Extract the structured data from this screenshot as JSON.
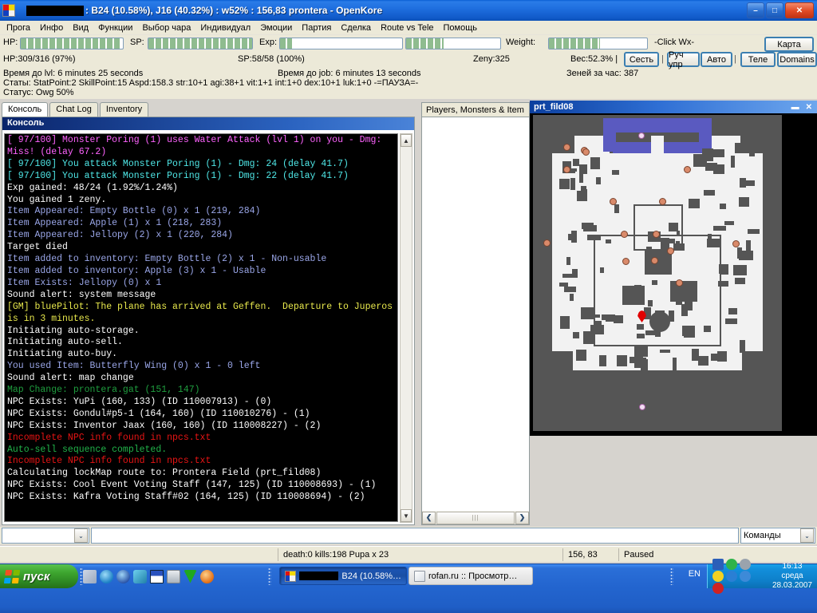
{
  "window": {
    "title": ": B24 (10.58%), J16 (40.32%) : w52% : 156,83 prontera - OpenKore",
    "minimize_label": "–",
    "maximize_label": "□",
    "close_label": "✕"
  },
  "menu": {
    "items": [
      "Прога",
      "Инфо",
      "Вид",
      "Функции",
      "Выбор чара",
      "Индивидуал",
      "Эмоции",
      "Партия",
      "Сделка",
      "Route vs Tele",
      "Помощь"
    ]
  },
  "gauges": {
    "hp_label": "HP:",
    "hp_percent": 97,
    "sp_label": "SP:",
    "sp_percent": 100,
    "exp_label": "Exp:",
    "exp_percent": 10,
    "job_percent": 40,
    "weight_label": "Weight:",
    "weight_percent": 52,
    "click_hint": "-Click Wx-"
  },
  "stats": {
    "hp_text": "HP:309/316 (97%)",
    "sp_text": "SP:58/58 (100%)",
    "zeny_text": "Zeny:325",
    "weight_text": "Вес:52.3% |",
    "time_lvl": "Время до lvl: 6 minutes 25 seconds",
    "time_job": "Время до job: 6 minutes 13 seconds",
    "zeny_per_hour": "Зеней за час: 387",
    "stats_line": "Статы: StatPoint:2  SkillPoint:15  Aspd:158.3  str:10+1 agi:38+1 vit:1+1 int:1+0 dex:10+1 luk:1+0   -=ПАУЗА=-",
    "status_line": "Статус: Owg 50%"
  },
  "toolbar": {
    "map_button": "Карта",
    "sit_button": "Сесть",
    "manual_button": "Руч упр",
    "auto_button": "Авто",
    "tele_button": "Теле",
    "domains_button": "Domains",
    "separator": "|"
  },
  "tabs": [
    {
      "label": "Консоль",
      "active": true
    },
    {
      "label": "Chat Log",
      "active": false
    },
    {
      "label": "Inventory",
      "active": false
    }
  ],
  "console": {
    "header": "Консоль",
    "lines": [
      {
        "text": "[ 97/100] Monster Poring (1) uses Water Attack (lvl 1) on you - Dmg:",
        "color": "#ff63ff"
      },
      {
        "text": "Miss! (delay 67.2)",
        "color": "#ff63ff"
      },
      {
        "text": "[ 97/100] You attack Monster Poring (1) - Dmg: 24 (delay 41.7)",
        "color": "#4fe8e8"
      },
      {
        "text": "[ 97/100] You attack Monster Poring (1) - Dmg: 22 (delay 41.7)",
        "color": "#4fe8e8"
      },
      {
        "text": "Exp gained: 48/24 (1.92%/1.24%)",
        "color": "#ffffff"
      },
      {
        "text": "You gained 1 zeny.",
        "color": "#ffffff"
      },
      {
        "text": "Item Appeared: Empty Bottle (0) x 1 (219, 284)",
        "color": "#9aa6e8"
      },
      {
        "text": "Item Appeared: Apple (1) x 1 (218, 283)",
        "color": "#9aa6e8"
      },
      {
        "text": "Item Appeared: Jellopy (2) x 1 (220, 284)",
        "color": "#9aa6e8"
      },
      {
        "text": "Target died",
        "color": "#ffffff"
      },
      {
        "text": "Item added to inventory: Empty Bottle (2) x 1 - Non-usable",
        "color": "#9aa6e8"
      },
      {
        "text": "Item added to inventory: Apple (3) x 1 - Usable",
        "color": "#9aa6e8"
      },
      {
        "text": "Item Exists: Jellopy (0) x 1",
        "color": "#9aa6e8"
      },
      {
        "text": "Sound alert: system message",
        "color": "#ffffff"
      },
      {
        "text": "[GM] bluePilot: The plane has arrived at Geffen.  Departure to Juperos",
        "color": "#e8e84c"
      },
      {
        "text": "is in 3 minutes.",
        "color": "#e8e84c"
      },
      {
        "text": "Initiating auto-storage.",
        "color": "#ffffff"
      },
      {
        "text": "Initiating auto-sell.",
        "color": "#ffffff"
      },
      {
        "text": "Initiating auto-buy.",
        "color": "#ffffff"
      },
      {
        "text": "You used Item: Butterfly Wing (0) x 1 - 0 left",
        "color": "#9aa6e8"
      },
      {
        "text": "Sound alert: map change",
        "color": "#ffffff"
      },
      {
        "text": "Map Change: prontera.gat (151, 147)",
        "color": "#1f9e3f"
      },
      {
        "text": "NPC Exists: YuPi (160, 133) (ID 110007913) - (0)",
        "color": "#ffffff"
      },
      {
        "text": "NPC Exists: Gondul#p5-1 (164, 160) (ID 110010276) - (1)",
        "color": "#ffffff"
      },
      {
        "text": "NPC Exists: Inventor Jaax (160, 160) (ID 110008227) - (2)",
        "color": "#ffffff"
      },
      {
        "text": "Incomplete NPC info found in npcs.txt",
        "color": "#e81414"
      },
      {
        "text": "Auto-sell sequence completed.",
        "color": "#21b44a"
      },
      {
        "text": "Incomplete NPC info found in npcs.txt",
        "color": "#e81414"
      },
      {
        "text": "Calculating lockMap route to: Prontera Field (prt_fild08)",
        "color": "#ffffff"
      },
      {
        "text": "NPC Exists: Cool Event Voting Staff (147, 125) (ID 110008693) - (1)",
        "color": "#ffffff"
      },
      {
        "text": "NPC Exists: Kafra Voting Staff#02 (164, 125) (ID 110008694) - (2)",
        "color": "#ffffff"
      }
    ],
    "scroll_up": "▲",
    "scroll_down": "▼"
  },
  "list_panel": {
    "tab_label": "Players, Monsters & Item",
    "scroll_left": "❮",
    "scroll_right": "❯",
    "thumb_glyph": "|||"
  },
  "map_window": {
    "title": "prt_fild08",
    "restore_label": "▬",
    "close_label": "✕"
  },
  "command_row": {
    "left_input_value": "",
    "left_dropdown_glyph": "⌄",
    "right_input_value": "",
    "commands_label": "Команды",
    "right_dropdown_glyph": "⌄"
  },
  "statusbar": {
    "kills_text": "death:0 kills:198 Pupa x 23",
    "coords_text": "156, 83",
    "state_text": "Paused"
  },
  "taskbar": {
    "start_label": "пуск",
    "quick_launch": [
      "show-desktop-icon",
      "internet-explorer-icon",
      "media-player-icon",
      "outlook-express-icon",
      "save-icon",
      "print-icon",
      "green-download-icon",
      "at-mail-icon"
    ],
    "items": [
      {
        "label": "B24 (10.58%…",
        "active": true,
        "icon": "openkore-icon"
      },
      {
        "label": "rofan.ru :: Просмотр…",
        "active": false,
        "icon": "ie-page-icon"
      }
    ],
    "language": "EN",
    "clock_time": "16:13",
    "clock_day": "среда",
    "clock_date": "28.03.2007"
  },
  "colors": {
    "titlebar_blue": "#1f6fdf",
    "console_bg": "#000000",
    "accent_green": "#8fbc8f",
    "taskbar_blue": "#2365cf",
    "start_green": "#3da52f"
  }
}
